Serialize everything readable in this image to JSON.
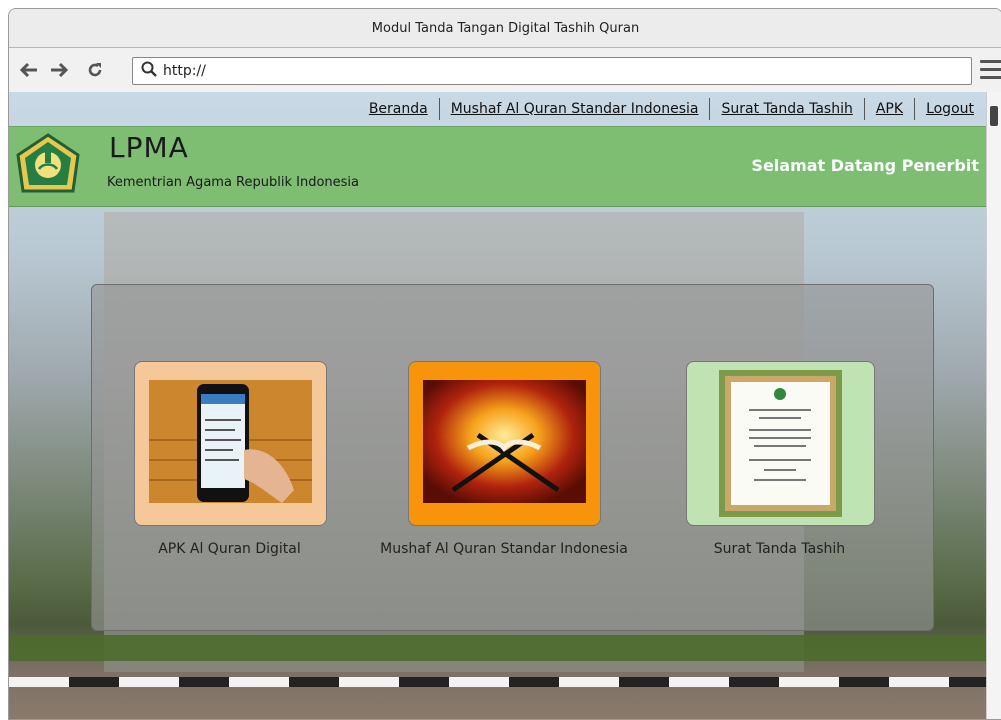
{
  "window": {
    "title": "Modul Tanda Tangan Digital Tashih Quran"
  },
  "browser": {
    "url": "http://"
  },
  "nav": {
    "links": [
      "Beranda",
      "Mushaf Al Quran Standar Indonesia",
      "Surat Tanda Tashih",
      "APK",
      "Logout"
    ]
  },
  "header": {
    "brand": "LPMA",
    "subtitle": "Kementrian Agama Republik Indonesia",
    "welcome": "Selamat Datang Penerbit"
  },
  "cards": [
    {
      "label": "APK Al Quran Digital",
      "bg": "#f5c89a"
    },
    {
      "label": "Mushaf Al Quran Standar Indonesia",
      "bg": "#f7940b"
    },
    {
      "label": "Surat Tanda Tashih",
      "bg": "#bfe3b3"
    }
  ],
  "colors": {
    "header": "#7bbd6d",
    "welcome_text": "#ffffff"
  },
  "icons": [
    "back-arrow-icon",
    "forward-arrow-icon",
    "reload-icon",
    "search-icon",
    "menu-icon",
    "kemenag-logo"
  ]
}
